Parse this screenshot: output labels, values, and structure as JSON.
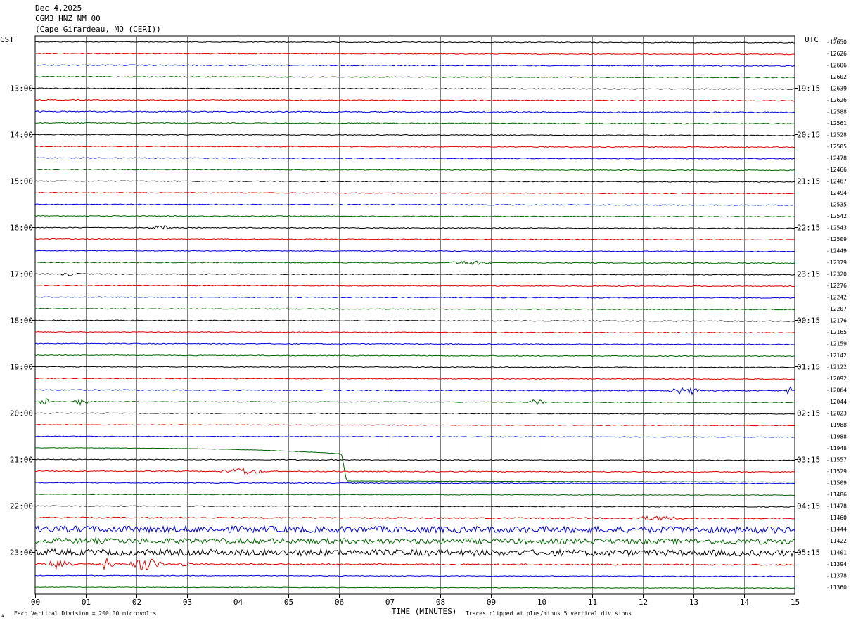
{
  "header": {
    "date": "Dec 4,2025",
    "station": "CGM3 HNZ NM 00",
    "location": "(Cape Girardeau, MO (CERI))"
  },
  "axes": {
    "left_zone": "CST",
    "right_zone": "UTC",
    "dc_label": "DC",
    "x_title": "TIME (MINUTES)",
    "footer_left": "Each Vertical Division =  200.00 microvolts",
    "footer_right": "Traces clipped at plus/minus 5 vertical divisions",
    "corner_mark": "A"
  },
  "colors": {
    "cycle": [
      "#000000",
      "#e00000",
      "#0000e0",
      "#006400"
    ],
    "grid": "#808080"
  },
  "chart_data": {
    "type": "line",
    "title": "CGM3 HNZ NM 00",
    "xlabel": "TIME (MINUTES)",
    "x_range": [
      0,
      15
    ],
    "x_ticks": [
      "00",
      "01",
      "02",
      "03",
      "04",
      "05",
      "06",
      "07",
      "08",
      "09",
      "10",
      "11",
      "12",
      "13",
      "14",
      "15"
    ],
    "left_hour_labels": [
      "13:00",
      "14:00",
      "15:00",
      "16:00",
      "17:00",
      "18:00",
      "19:00",
      "20:00",
      "21:00",
      "22:00",
      "23:00"
    ],
    "right_hour_labels": [
      "19:15",
      "20:15",
      "21:15",
      "22:15",
      "23:15",
      "00:15",
      "01:15",
      "02:15",
      "03:15",
      "04:15",
      "05:15"
    ],
    "traces_per_hour": 4,
    "first_labeled_trace": 4,
    "dc_offsets": [
      "-12650",
      "-12626",
      "-12606",
      "-12602",
      "-12639",
      "-12626",
      "-12588",
      "-12561",
      "-12528",
      "-12505",
      "-12478",
      "-12466",
      "-12467",
      "-12494",
      "-12535",
      "-12542",
      "-12543",
      "-12509",
      "-12449",
      "-12379",
      "-12320",
      "-12276",
      "-12242",
      "-12207",
      "-12176",
      "-12165",
      "-12159",
      "-12142",
      "-12122",
      "-12092",
      "-12064",
      "-12044",
      "-12023",
      "-11988",
      "-11988",
      "-11948",
      "-11557",
      "-11529",
      "-11509",
      "-11486",
      "-11478",
      "-11460",
      "-11444",
      "-11422",
      "-11401",
      "-11394",
      "-11378",
      "-11360"
    ],
    "noise_level": [
      0.6,
      0.6,
      0.7,
      0.7,
      0.6,
      0.7,
      0.8,
      0.7,
      0.6,
      0.6,
      0.6,
      0.6,
      0.6,
      0.6,
      0.6,
      0.6,
      0.6,
      0.6,
      0.6,
      0.7,
      0.6,
      0.6,
      0.6,
      0.6,
      0.6,
      0.6,
      0.6,
      0.6,
      0.6,
      0.6,
      0.7,
      0.6,
      0.6,
      0.5,
      0.5,
      0.3,
      0.6,
      0.7,
      0.6,
      0.5,
      0.6,
      0.9,
      4.5,
      3.8,
      4.5,
      1.0,
      0.5,
      0.4
    ],
    "bursts": [
      {
        "trace": 16,
        "x": 2.5,
        "width": 0.3,
        "amp": 3
      },
      {
        "trace": 19,
        "x": 8.6,
        "width": 0.5,
        "amp": 3
      },
      {
        "trace": 20,
        "x": 0.7,
        "width": 0.3,
        "amp": 2
      },
      {
        "trace": 30,
        "x": 12.7,
        "width": 0.2,
        "amp": 6
      },
      {
        "trace": 30,
        "x": 13.0,
        "width": 0.15,
        "amp": 6
      },
      {
        "trace": 30,
        "x": 14.9,
        "width": 0.1,
        "amp": 7
      },
      {
        "trace": 31,
        "x": 0.2,
        "width": 0.2,
        "amp": 5
      },
      {
        "trace": 31,
        "x": 0.9,
        "width": 0.2,
        "amp": 5
      },
      {
        "trace": 31,
        "x": 9.9,
        "width": 0.2,
        "amp": 4
      },
      {
        "trace": 37,
        "x": 4.1,
        "width": 0.5,
        "amp": 5
      },
      {
        "trace": 41,
        "x": 12.3,
        "width": 0.6,
        "amp": 3
      },
      {
        "trace": 45,
        "x": 0.5,
        "width": 0.3,
        "amp": 9
      },
      {
        "trace": 45,
        "x": 1.4,
        "width": 0.2,
        "amp": 9
      },
      {
        "trace": 45,
        "x": 2.2,
        "width": 0.4,
        "amp": 10
      },
      {
        "trace": 45,
        "x": 2.95,
        "width": 0.1,
        "amp": 8
      }
    ],
    "drift_event": {
      "trace": 35,
      "step_minute": 6.05,
      "start_minute": 0,
      "sag_at_step": 0.25,
      "drop_traces": 2.85
    }
  }
}
